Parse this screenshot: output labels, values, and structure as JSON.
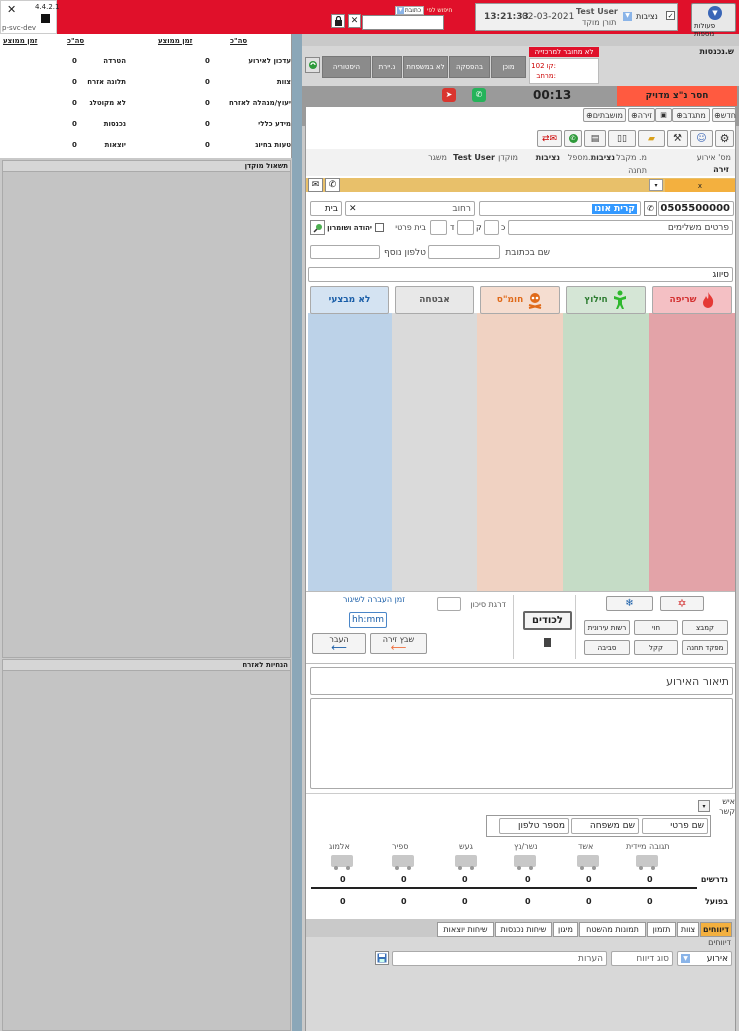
{
  "header": {
    "version": "4.4.2.1",
    "env": "p-svc-dev",
    "actions_label": "פעולות נוספות",
    "role_checkbox": "נציבות",
    "user_name": "Test User",
    "user_role": "תורן מוקד",
    "date": "02-03-2021",
    "time": "13:21:33",
    "search_mode": "כתובת",
    "search_hint": "חיפוש לפי"
  },
  "stats": {
    "col_headers": [
      "זמן ממוצע",
      "סה\"כ",
      "זמן ממוצע",
      "סה\"כ"
    ],
    "right_rows": [
      {
        "label": "עדכון לאירוע",
        "value": "0"
      },
      {
        "label": "צוות",
        "value": "0"
      },
      {
        "label": "יעוץ/מנהלה לאזרח",
        "value": "0"
      },
      {
        "label": "מידע כללי",
        "value": "0"
      },
      {
        "label": "טעות בחיוג",
        "value": "0"
      }
    ],
    "left_rows": [
      {
        "label": "הטרדה",
        "value": "0"
      },
      {
        "label": "תלונה אזרח",
        "value": "0"
      },
      {
        "label": "לא מקוטלג",
        "value": "0"
      },
      {
        "label": "נכנסות",
        "value": "0"
      },
      {
        "label": "יוצאות",
        "value": "0"
      }
    ]
  },
  "panels": {
    "center_query": "תשאול מוקדן",
    "citizen_guide": "הנחיות לאזרח"
  },
  "incoming": {
    "title": "ש.נכנסות",
    "not_connected": "לא מחובר למרכזייה",
    "line": "קו 102:",
    "ext": "מרחב:",
    "tabs": [
      "היסטוריה",
      "נ.יירת",
      "לא במשפחת",
      "בהפסקה",
      "מוכן"
    ],
    "alert": "חסר נ\"צ מדויק",
    "timer": "00:13"
  },
  "toolbar": {
    "new_label": "חדש",
    "tracked_label": "מתגדב",
    "arena_label": "זירה",
    "stations_label": "מושבתים"
  },
  "incident_info": {
    "labels": [
      "מס' אירוע",
      "מ. מקבל",
      "מ.מספל",
      "מוקדן",
      "משגר"
    ],
    "values": [
      "",
      "נציבות",
      "נציבות",
      "Test User",
      ""
    ],
    "arena_title": "זירה",
    "station_label": "תחנה",
    "tab_x": "x"
  },
  "address": {
    "phone": "0505500000",
    "city": "קרית אונו",
    "street_placeholder": "רחוב",
    "house_placeholder": "בית",
    "details_placeholder": "פרטים משלימים",
    "letters": [
      "כ",
      "ק",
      "ד"
    ],
    "private_house": "בית פרטי",
    "region": "יהודה ושומרון",
    "written_name": "שם בכתובת",
    "extra_phone": "טלפון נוסף",
    "classification": "סיווג"
  },
  "categories": [
    {
      "label": "שריפה",
      "color": "#d32f2f",
      "bg": "#e3a3a8",
      "btn": "#f4c0c4"
    },
    {
      "label": "חילוץ",
      "color": "#2e7d32",
      "bg": "#c5dcc6",
      "btn": "#d5e6d6"
    },
    {
      "label": "חומ\"ס",
      "color": "#e06a1a",
      "bg": "#f0d2c2",
      "btn": "#f5ddd0"
    },
    {
      "label": "אבטחה",
      "color": "#555555",
      "bg": "#dadada",
      "btn": "#e8e8e8"
    },
    {
      "label": "לא מבצעי",
      "color": "#1a5ea8",
      "bg": "#bcd2e8",
      "btn": "#d4e3f2"
    }
  ],
  "dispatch": {
    "buttons": [
      "קמבצ",
      "חוי",
      "רשות עירונית",
      "מפקד תחנה",
      "קקל",
      "סביבה"
    ],
    "to_codes": "לכודים",
    "risk_label": "דרגת סיכון",
    "transfer_time": "זמן העברה לשיגור",
    "time_value": "hh:mm",
    "assign_arena": "שבץ זירה",
    "pass": "העבר"
  },
  "description": {
    "title": "תיאור האירוע"
  },
  "contact": {
    "label": "איש קשר",
    "first_name": "שם פרטי",
    "last_name": "שם משפחה",
    "phone": "מספר טלפון"
  },
  "forces": {
    "types": [
      "תגובה מיידית",
      "אשד",
      "נשר/נץ",
      "געש",
      "ספיר",
      "אלמוג"
    ],
    "required_label": "נדרשים",
    "actual_label": "בפועל",
    "required": [
      "0",
      "0",
      "0",
      "0",
      "0",
      "0"
    ],
    "actual": [
      "0",
      "0",
      "0",
      "0",
      "0",
      "0"
    ]
  },
  "reports": {
    "tabs": [
      "דיווחים",
      "צוות",
      "תזמון",
      "תמונות מהשטח",
      "מיגון",
      "שיחות נכנסות",
      "שיחות יוצאות"
    ],
    "section": "דיווחים",
    "type_value": "אירוע",
    "report_type": "סוג דיווח",
    "notes": "הערות"
  }
}
